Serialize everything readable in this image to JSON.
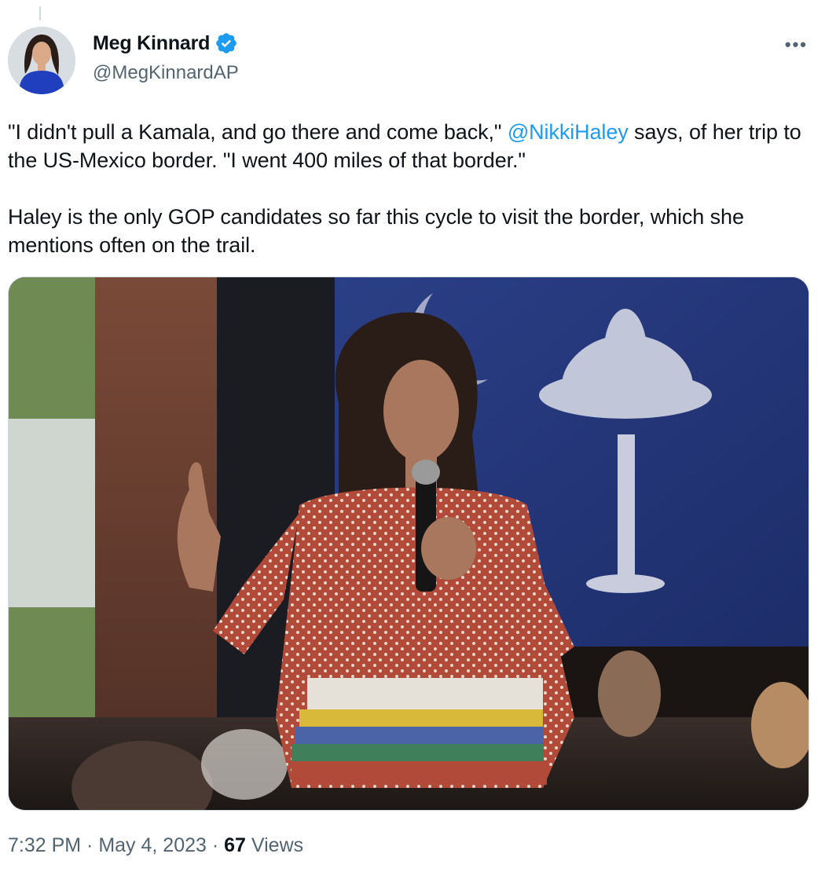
{
  "tweet": {
    "author": {
      "display_name": "Meg Kinnard",
      "handle": "@MegKinnardAP",
      "verified": true,
      "verified_icon": "verified-badge-icon"
    },
    "more_icon": "•••",
    "paragraph_1": {
      "before_mention": "\"I didn't pull a Kamala, and go there and come back,\" ",
      "mention": "@NikkiHaley",
      "after_mention": " says, of her trip to the US-Mexico border. \"I went 400 miles of that border.\""
    },
    "paragraph_2": "Haley is the only GOP candidates so far this cycle to visit the border, which she mentions often on the trail.",
    "time": "7:32 PM",
    "separator_1": " · ",
    "date": "May 4, 2023",
    "separator_2": " · ",
    "views_count": "67",
    "views_label": " Views"
  },
  "colors": {
    "link": "#1d9bf0",
    "secondary_text": "#536471",
    "verified": "#1d9bf0"
  }
}
